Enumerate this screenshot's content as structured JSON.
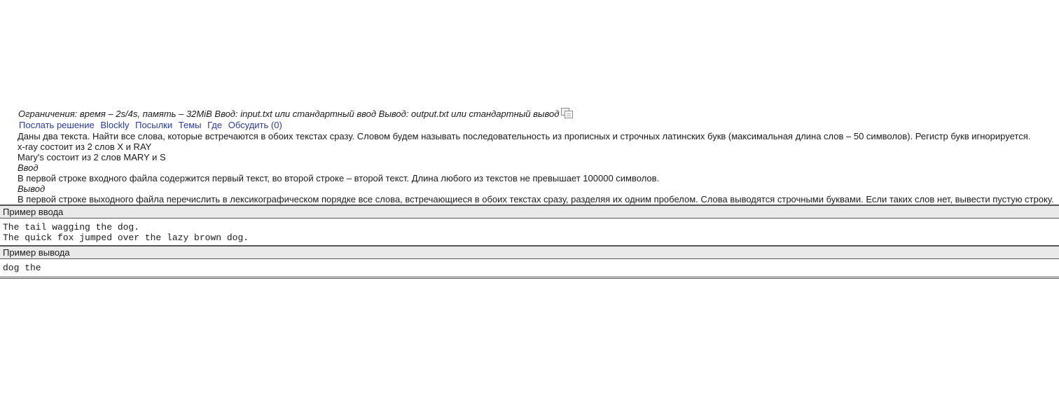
{
  "limits": "Ограничения: время – 2s/4s, память – 32MiB Ввод: input.txt или стандартный ввод Вывод: output.txt или стандартный вывод",
  "copy_icon": "copy-icon",
  "links": [
    "Послать решение",
    "Blockly",
    "Посылки",
    "Темы",
    "Где",
    "Обсудить (0)"
  ],
  "link_color": "#2a3aa8",
  "statement": {
    "description": "Даны два текста. Найти все слова, которые встречаются в обоих текстах сразу. Словом будем называть последовательность из прописных и строчных латинских букв (максимальная длина слов – 50 символов). Регистр букв игнорируется.",
    "example1": "x-ray состоит из 2 слов X и RAY",
    "example2": "Mary's состоит из 2 слов MARY и S",
    "input_heading": "Ввод",
    "input_text": "В первой строке входного файла содержится первый текст, во второй строке – второй текст. Длина любого из текстов не превышает 100000 символов.",
    "output_heading": "Вывод",
    "output_text": "В первой строке выходного файла перечислить в лексикографическом порядке все слова, встречающиеся в обоих текстах сразу, разделяя их одним пробелом. Слова выводятся строчными буквами. Если таких слов нет, вывести пустую строку."
  },
  "sample_input": {
    "title": "Пример ввода",
    "lines": [
      "The tail wagging the dog.",
      "The quick fox jumped over the lazy brown dog."
    ]
  },
  "sample_output": {
    "title": "Пример вывода",
    "lines": [
      "dog the"
    ]
  }
}
